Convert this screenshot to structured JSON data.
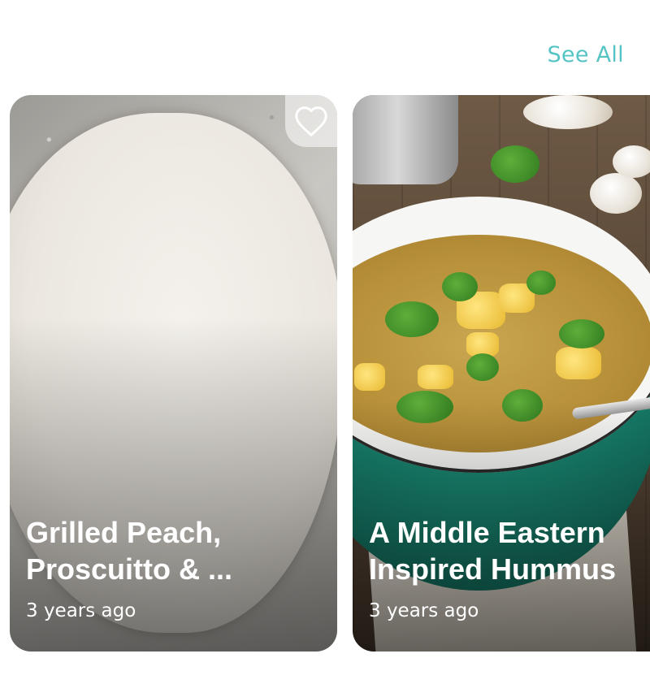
{
  "header": {
    "see_all_label": "See All"
  },
  "cards": [
    {
      "title": "Grilled Peach,\nProscuitto & ...",
      "time": "3 years ago",
      "image": "pizza-dough"
    },
    {
      "title": "A Middle Eastern\nInspired Hummus",
      "time": "3 years ago",
      "image": "vegetable-soup"
    }
  ],
  "icons": {
    "favorite": "heart-outline-icon"
  },
  "colors": {
    "accent": "#56c4c5",
    "card_text": "#ffffff"
  }
}
